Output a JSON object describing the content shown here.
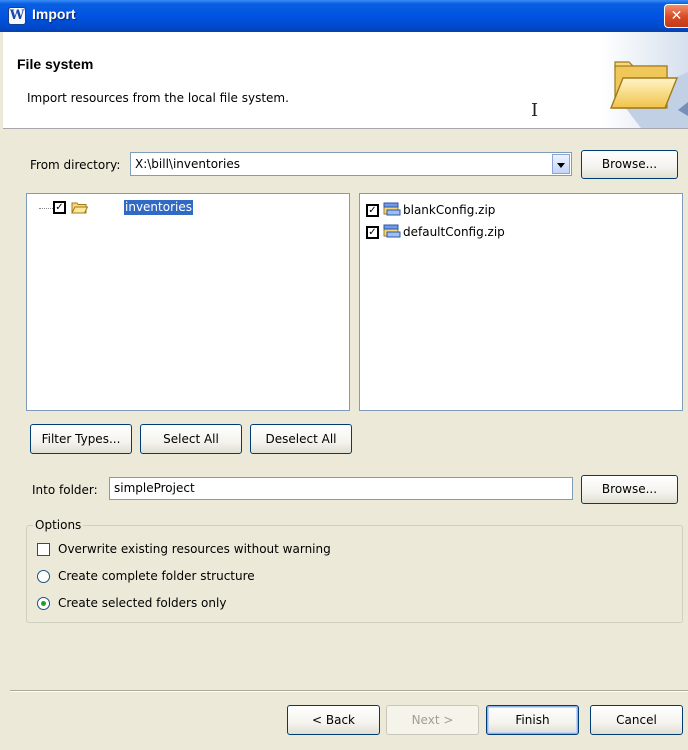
{
  "window": {
    "title": "Import",
    "app_icon_glyph": "W",
    "close_glyph": "✕"
  },
  "header": {
    "title": "File system",
    "description": "Import resources from the local file system."
  },
  "source": {
    "from_label": "From directory:",
    "from_value": "X:\\bill\\inventories",
    "browse_label": "Browse..."
  },
  "tree": {
    "items": [
      {
        "label": "inventories",
        "checked": true,
        "selected": true,
        "icon": "folder-icon"
      }
    ]
  },
  "files": {
    "items": [
      {
        "label": "blankConfig.zip",
        "checked": true,
        "icon": "archive-icon"
      },
      {
        "label": "defaultConfig.zip",
        "checked": true,
        "icon": "archive-icon"
      }
    ]
  },
  "selection_buttons": {
    "filter_types": "Filter Types...",
    "select_all": "Select All",
    "deselect_all": "Deselect All"
  },
  "destination": {
    "into_label": "Into folder:",
    "into_value": "simpleProject",
    "browse_label": "Browse..."
  },
  "options": {
    "group_label": "Options",
    "overwrite": {
      "label": "Overwrite existing resources without warning",
      "checked": false
    },
    "complete_structure": {
      "label": "Create complete folder structure",
      "selected": false
    },
    "selected_only": {
      "label": "Create selected folders only",
      "selected": true
    }
  },
  "footer": {
    "back": "< Back",
    "next": "Next >",
    "finish": "Finish",
    "cancel": "Cancel"
  },
  "colors": {
    "titlebar": "#0054e3",
    "selection": "#316ac5",
    "checkmark": "#21a121",
    "dialog_bg": "#ece9d8"
  }
}
